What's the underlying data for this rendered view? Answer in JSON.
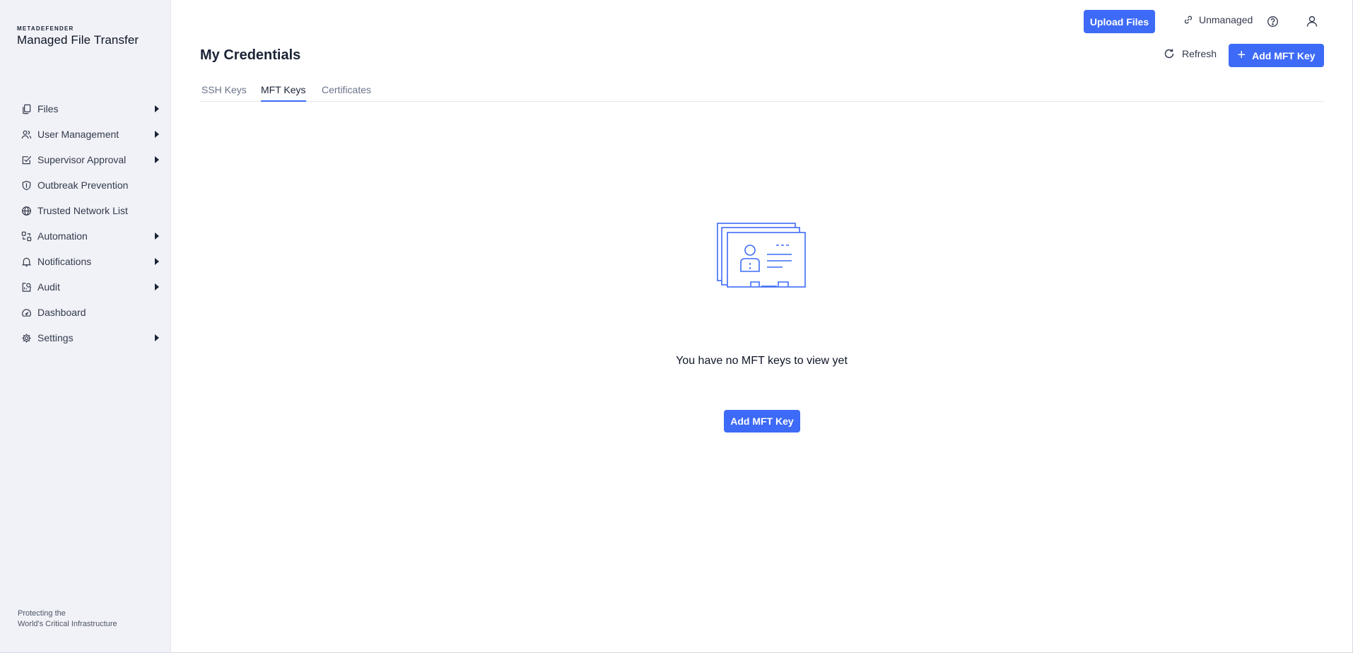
{
  "brand": {
    "small": "METADEFENDER",
    "large": "Managed File Transfer"
  },
  "sidebar": {
    "items": [
      {
        "label": "Files",
        "icon": "files-icon",
        "has_submenu": true
      },
      {
        "label": "User Management",
        "icon": "users-icon",
        "has_submenu": true
      },
      {
        "label": "Supervisor Approval",
        "icon": "checkbox-icon",
        "has_submenu": true
      },
      {
        "label": "Outbreak Prevention",
        "icon": "shield-icon",
        "has_submenu": false
      },
      {
        "label": "Trusted Network List",
        "icon": "globe-icon",
        "has_submenu": false
      },
      {
        "label": "Automation",
        "icon": "automation-icon",
        "has_submenu": true
      },
      {
        "label": "Notifications",
        "icon": "bell-icon",
        "has_submenu": true
      },
      {
        "label": "Audit",
        "icon": "audit-icon",
        "has_submenu": true
      },
      {
        "label": "Dashboard",
        "icon": "gauge-icon",
        "has_submenu": false
      },
      {
        "label": "Settings",
        "icon": "gear-icon",
        "has_submenu": true
      }
    ],
    "tagline_line1": "Protecting the",
    "tagline_line2": "World's Critical Infrastructure"
  },
  "topbar": {
    "upload_label": "Upload Files",
    "unmanaged_label": "Unmanaged"
  },
  "page": {
    "title": "My Credentials",
    "refresh_label": "Refresh",
    "add_key_label": "Add MFT Key"
  },
  "tabs": [
    {
      "label": "SSH Keys",
      "active": false
    },
    {
      "label": "MFT Keys",
      "active": true
    },
    {
      "label": "Certificates",
      "active": false
    }
  ],
  "empty_state": {
    "message": "You have no MFT keys to view yet",
    "button_label": "Add MFT Key"
  },
  "colors": {
    "accent": "#3d6af6",
    "sidebar_bg": "#f1f2f7",
    "text": "#1b2336"
  }
}
